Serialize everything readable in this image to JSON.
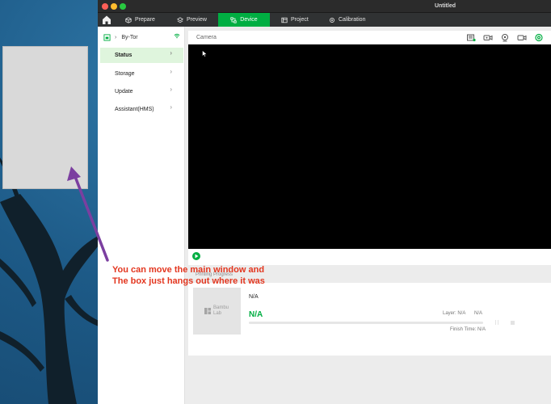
{
  "window": {
    "title": "Untitled"
  },
  "tabs": [
    {
      "label": "Prepare",
      "icon": "cube-icon"
    },
    {
      "label": "Preview",
      "icon": "layers-icon"
    },
    {
      "label": "Device",
      "icon": "device-icon",
      "active": true
    },
    {
      "label": "Project",
      "icon": "project-icon"
    },
    {
      "label": "Calibration",
      "icon": "calibration-icon"
    }
  ],
  "sidebar": {
    "printer_name": "By-Tor",
    "items": [
      {
        "label": "Status",
        "active": true
      },
      {
        "label": "Storage"
      },
      {
        "label": "Update"
      },
      {
        "label": "Assistant(HMS)"
      }
    ]
  },
  "camera": {
    "label": "Camera",
    "icons": [
      "sd-card-icon",
      "record-video-icon",
      "timelapse-icon",
      "camera-icon",
      "settings-icon"
    ]
  },
  "printing": {
    "label": "Printing Progress",
    "task_name": "N/A",
    "percent_text": "N/A",
    "progress": 0,
    "layer_text": "Layer: N/A",
    "layer_extra": "N/A",
    "finish_text": "Finish Time: N/A",
    "thumbnail_logo": "Bambu Lab"
  },
  "annotation": {
    "line1": "You can move the main window and",
    "line2": "The box just hangs out where it was"
  },
  "colors": {
    "accent": "#00ae42",
    "annotation": "#e3361f",
    "arrow": "#7b3fa0"
  }
}
